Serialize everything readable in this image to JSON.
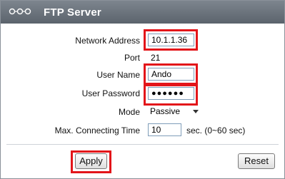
{
  "window": {
    "title": "FTP Server",
    "title_icon": "dots-icon"
  },
  "form": {
    "network_address": {
      "label": "Network Address",
      "value": "10.1.1.36"
    },
    "port": {
      "label": "Port",
      "value": "21"
    },
    "user_name": {
      "label": "User Name",
      "value": "Ando"
    },
    "user_password": {
      "label": "User Password",
      "value": "●●●●●●"
    },
    "mode": {
      "label": "Mode",
      "value": "Passive"
    },
    "max_connecting_time": {
      "label": "Max. Connecting Time",
      "value": "10",
      "unit_hint": "sec. (0~60 sec)"
    }
  },
  "buttons": {
    "apply": "Apply",
    "reset": "Reset"
  },
  "colors": {
    "highlight": "#e3151a",
    "titlebar": "#6b737c"
  }
}
